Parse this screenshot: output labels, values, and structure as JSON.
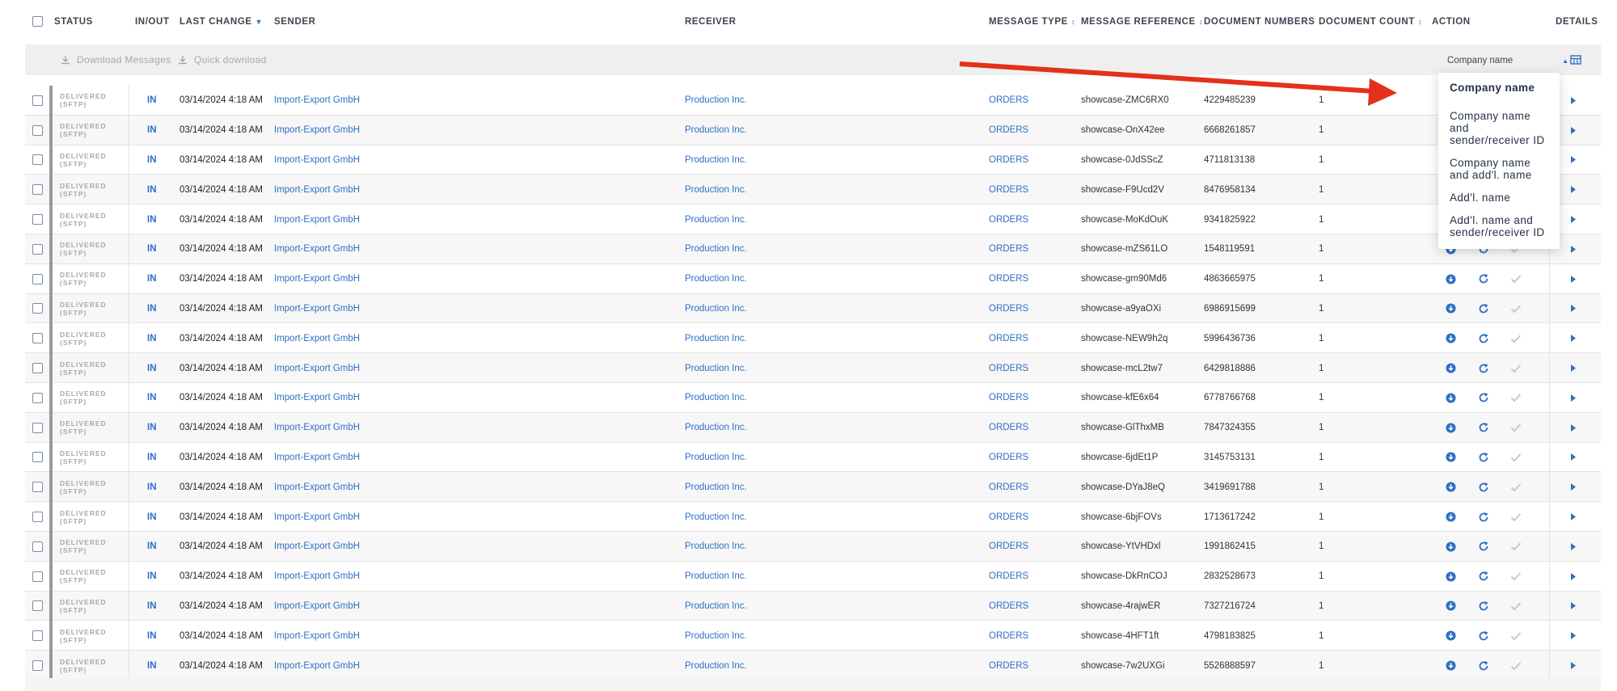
{
  "header": {
    "columns": {
      "status": "STATUS",
      "inout": "IN/OUT",
      "last_change": "LAST CHANGE",
      "sender": "SENDER",
      "receiver": "RECEIVER",
      "message_type": "MESSAGE TYPE",
      "message_reference": "MESSAGE REFERENCE",
      "document_numbers": "DOCUMENT NUMBERS",
      "document_count": "DOCUMENT COUNT",
      "action": "ACTION",
      "details": "DETAILS"
    }
  },
  "toolbar": {
    "download_messages": "Download Messages",
    "quick_download": "Quick download",
    "company_select_value": "Company name"
  },
  "dropdown": {
    "options": [
      "Company name",
      "Company name and sender/receiver ID",
      "Company name and add'l. name",
      "Add'l. name",
      "Add'l. name and sender/receiver ID"
    ],
    "selected_index": 0
  },
  "rows": [
    {
      "status_line1": "DELIVERED",
      "status_line2": "(SFTP)",
      "inout": "IN",
      "last_change": "03/14/2024 4:18 AM",
      "sender": "Import-Export GmbH",
      "receiver": "Production Inc.",
      "message_type": "ORDERS",
      "message_reference": "showcase-ZMC6RX0",
      "document_numbers": "4229485239",
      "document_count": "1"
    },
    {
      "status_line1": "DELIVERED",
      "status_line2": "(SFTP)",
      "inout": "IN",
      "last_change": "03/14/2024 4:18 AM",
      "sender": "Import-Export GmbH",
      "receiver": "Production Inc.",
      "message_type": "ORDERS",
      "message_reference": "showcase-OnX42ee",
      "document_numbers": "6668261857",
      "document_count": "1"
    },
    {
      "status_line1": "DELIVERED",
      "status_line2": "(SFTP)",
      "inout": "IN",
      "last_change": "03/14/2024 4:18 AM",
      "sender": "Import-Export GmbH",
      "receiver": "Production Inc.",
      "message_type": "ORDERS",
      "message_reference": "showcase-0JdSScZ",
      "document_numbers": "4711813138",
      "document_count": "1"
    },
    {
      "status_line1": "DELIVERED",
      "status_line2": "(SFTP)",
      "inout": "IN",
      "last_change": "03/14/2024 4:18 AM",
      "sender": "Import-Export GmbH",
      "receiver": "Production Inc.",
      "message_type": "ORDERS",
      "message_reference": "showcase-F9Ucd2V",
      "document_numbers": "8476958134",
      "document_count": "1"
    },
    {
      "status_line1": "DELIVERED",
      "status_line2": "(SFTP)",
      "inout": "IN",
      "last_change": "03/14/2024 4:18 AM",
      "sender": "Import-Export GmbH",
      "receiver": "Production Inc.",
      "message_type": "ORDERS",
      "message_reference": "showcase-MoKdOuK",
      "document_numbers": "9341825922",
      "document_count": "1"
    },
    {
      "status_line1": "DELIVERED",
      "status_line2": "(SFTP)",
      "inout": "IN",
      "last_change": "03/14/2024 4:18 AM",
      "sender": "Import-Export GmbH",
      "receiver": "Production Inc.",
      "message_type": "ORDERS",
      "message_reference": "showcase-mZS61LO",
      "document_numbers": "1548119591",
      "document_count": "1"
    },
    {
      "status_line1": "DELIVERED",
      "status_line2": "(SFTP)",
      "inout": "IN",
      "last_change": "03/14/2024 4:18 AM",
      "sender": "Import-Export GmbH",
      "receiver": "Production Inc.",
      "message_type": "ORDERS",
      "message_reference": "showcase-gm90Md6",
      "document_numbers": "4863665975",
      "document_count": "1"
    },
    {
      "status_line1": "DELIVERED",
      "status_line2": "(SFTP)",
      "inout": "IN",
      "last_change": "03/14/2024 4:18 AM",
      "sender": "Import-Export GmbH",
      "receiver": "Production Inc.",
      "message_type": "ORDERS",
      "message_reference": "showcase-a9yaOXi",
      "document_numbers": "6986915699",
      "document_count": "1"
    },
    {
      "status_line1": "DELIVERED",
      "status_line2": "(SFTP)",
      "inout": "IN",
      "last_change": "03/14/2024 4:18 AM",
      "sender": "Import-Export GmbH",
      "receiver": "Production Inc.",
      "message_type": "ORDERS",
      "message_reference": "showcase-NEW9h2q",
      "document_numbers": "5996436736",
      "document_count": "1"
    },
    {
      "status_line1": "DELIVERED",
      "status_line2": "(SFTP)",
      "inout": "IN",
      "last_change": "03/14/2024 4:18 AM",
      "sender": "Import-Export GmbH",
      "receiver": "Production Inc.",
      "message_type": "ORDERS",
      "message_reference": "showcase-mcL2tw7",
      "document_numbers": "6429818886",
      "document_count": "1"
    },
    {
      "status_line1": "DELIVERED",
      "status_line2": "(SFTP)",
      "inout": "IN",
      "last_change": "03/14/2024 4:18 AM",
      "sender": "Import-Export GmbH",
      "receiver": "Production Inc.",
      "message_type": "ORDERS",
      "message_reference": "showcase-kfE6x64",
      "document_numbers": "6778766768",
      "document_count": "1"
    },
    {
      "status_line1": "DELIVERED",
      "status_line2": "(SFTP)",
      "inout": "IN",
      "last_change": "03/14/2024 4:18 AM",
      "sender": "Import-Export GmbH",
      "receiver": "Production Inc.",
      "message_type": "ORDERS",
      "message_reference": "showcase-GlThxMB",
      "document_numbers": "7847324355",
      "document_count": "1"
    },
    {
      "status_line1": "DELIVERED",
      "status_line2": "(SFTP)",
      "inout": "IN",
      "last_change": "03/14/2024 4:18 AM",
      "sender": "Import-Export GmbH",
      "receiver": "Production Inc.",
      "message_type": "ORDERS",
      "message_reference": "showcase-6jdEt1P",
      "document_numbers": "3145753131",
      "document_count": "1"
    },
    {
      "status_line1": "DELIVERED",
      "status_line2": "(SFTP)",
      "inout": "IN",
      "last_change": "03/14/2024 4:18 AM",
      "sender": "Import-Export GmbH",
      "receiver": "Production Inc.",
      "message_type": "ORDERS",
      "message_reference": "showcase-DYaJ8eQ",
      "document_numbers": "3419691788",
      "document_count": "1"
    },
    {
      "status_line1": "DELIVERED",
      "status_line2": "(SFTP)",
      "inout": "IN",
      "last_change": "03/14/2024 4:18 AM",
      "sender": "Import-Export GmbH",
      "receiver": "Production Inc.",
      "message_type": "ORDERS",
      "message_reference": "showcase-6bjFOVs",
      "document_numbers": "1713617242",
      "document_count": "1"
    },
    {
      "status_line1": "DELIVERED",
      "status_line2": "(SFTP)",
      "inout": "IN",
      "last_change": "03/14/2024 4:18 AM",
      "sender": "Import-Export GmbH",
      "receiver": "Production Inc.",
      "message_type": "ORDERS",
      "message_reference": "showcase-YtVHDxl",
      "document_numbers": "1991862415",
      "document_count": "1"
    },
    {
      "status_line1": "DELIVERED",
      "status_line2": "(SFTP)",
      "inout": "IN",
      "last_change": "03/14/2024 4:18 AM",
      "sender": "Import-Export GmbH",
      "receiver": "Production Inc.",
      "message_type": "ORDERS",
      "message_reference": "showcase-DkRnCOJ",
      "document_numbers": "2832528673",
      "document_count": "1"
    },
    {
      "status_line1": "DELIVERED",
      "status_line2": "(SFTP)",
      "inout": "IN",
      "last_change": "03/14/2024 4:18 AM",
      "sender": "Import-Export GmbH",
      "receiver": "Production Inc.",
      "message_type": "ORDERS",
      "message_reference": "showcase-4rajwER",
      "document_numbers": "7327216724",
      "document_count": "1"
    },
    {
      "status_line1": "DELIVERED",
      "status_line2": "(SFTP)",
      "inout": "IN",
      "last_change": "03/14/2024 4:18 AM",
      "sender": "Import-Export GmbH",
      "receiver": "Production Inc.",
      "message_type": "ORDERS",
      "message_reference": "showcase-4HFT1ft",
      "document_numbers": "4798183825",
      "document_count": "1"
    },
    {
      "status_line1": "DELIVERED",
      "status_line2": "(SFTP)",
      "inout": "IN",
      "last_change": "03/14/2024 4:18 AM",
      "sender": "Import-Export GmbH",
      "receiver": "Production Inc.",
      "message_type": "ORDERS",
      "message_reference": "showcase-7w2UXGi",
      "document_numbers": "5526888597",
      "document_count": "1"
    }
  ],
  "icons": {
    "download": "download-circle-icon",
    "resend": "refresh-icon",
    "confirm": "check-icon",
    "details": "caret-right-icon",
    "columns": "table-columns-icon"
  },
  "colors": {
    "link": "#2f6ec4",
    "status_bar": "#9a9a9a",
    "toolbar_bg": "#efefef",
    "annotation_arrow": "#e3311b"
  }
}
